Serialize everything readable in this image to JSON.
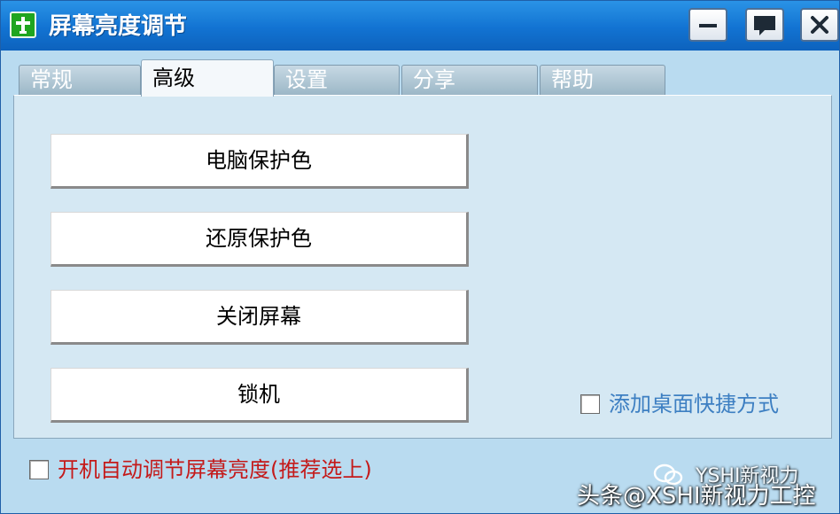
{
  "window": {
    "title": "屏幕亮度调节",
    "icon": "app-cross-icon",
    "controls": [
      {
        "name": "minimize",
        "icon": "minimize-icon"
      },
      {
        "name": "feedback",
        "icon": "chat-bubble-icon"
      },
      {
        "name": "close",
        "icon": "close-x-icon"
      }
    ]
  },
  "tabs": [
    {
      "label": "常规",
      "active": false
    },
    {
      "label": "高级",
      "active": true
    },
    {
      "label": "设置",
      "active": false
    },
    {
      "label": "分享",
      "active": false
    },
    {
      "label": "帮助",
      "active": false
    }
  ],
  "advanced": {
    "buttons": [
      {
        "label": "电脑保护色"
      },
      {
        "label": "还原保护色"
      },
      {
        "label": "关闭屏幕"
      },
      {
        "label": "锁机"
      }
    ],
    "desktop_shortcut": {
      "label": "添加桌面快捷方式",
      "checked": false
    }
  },
  "footer": {
    "autostart": {
      "label": "开机自动调节屏幕亮度(推荐选上)",
      "checked": false
    }
  },
  "watermark": {
    "line1": "YSHI新视力",
    "line2": "头条@XSHI新视力工控"
  },
  "colors": {
    "titlebar": "#1273d2",
    "window_bg": "#b9dbf0",
    "panel_bg": "#d5e8f3",
    "shortcut_text": "#3d7fc2",
    "autostart_text": "#c41a1a"
  }
}
